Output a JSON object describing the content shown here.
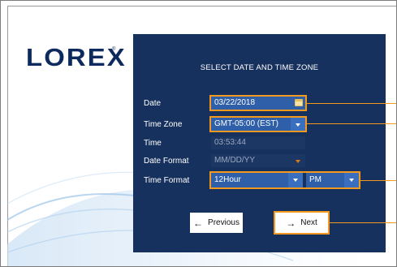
{
  "brand": {
    "logo_text": "LOREX",
    "trademark": "®"
  },
  "dialog": {
    "title": "SELECT DATE AND TIME ZONE",
    "date": {
      "label": "Date",
      "value": "03/22/2018",
      "icon": "calendar-icon"
    },
    "time_zone": {
      "label": "Time Zone",
      "value": "GMT-05:00 (EST)"
    },
    "time": {
      "label": "Time",
      "value": "03:53:44"
    },
    "date_format": {
      "label": "Date Format",
      "value": "MM/DD/YY"
    },
    "time_format": {
      "label": "Time Format",
      "value": "12Hour",
      "meridiem": "PM"
    },
    "buttons": {
      "previous": "Previous",
      "next": "Next",
      "previous_arrow": "←",
      "next_arrow": "→"
    }
  },
  "colors": {
    "panel": "#17315e",
    "field": "#2e5fa8",
    "highlight": "#f39a1e",
    "logo": "#0d2a5e"
  }
}
